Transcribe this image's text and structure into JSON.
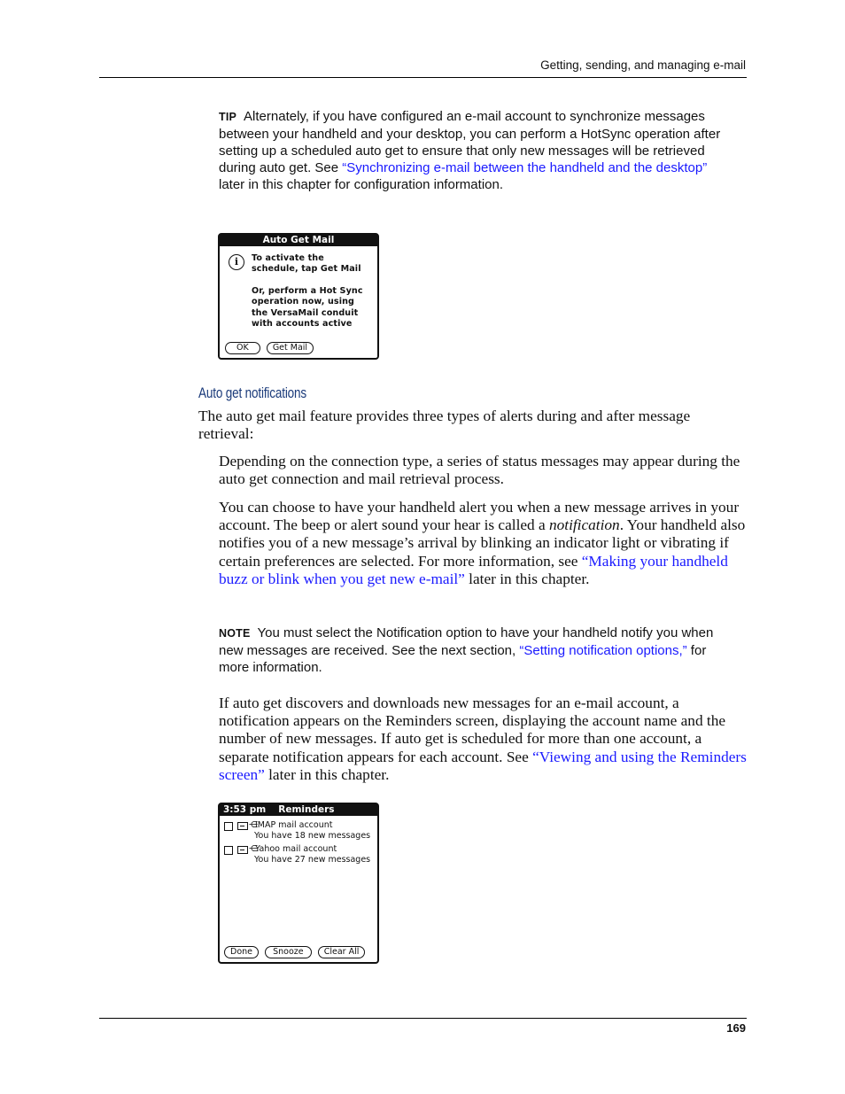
{
  "header": {
    "running_title": "Getting, sending, and managing e-mail"
  },
  "footer": {
    "page_number": "169"
  },
  "tip": {
    "label": "TIP",
    "text_before": "Alternately, if you have configured an e-mail account to synchronize messages between your handheld and your desktop, you can perform a HotSync operation after setting up a scheduled auto get to ensure that only new messages will be retrieved during auto get. See ",
    "link": "“Synchronizing e-mail between the handheld and the desktop”",
    "text_after": " later in this chapter for configuration information."
  },
  "auto_get_dialog": {
    "title": "Auto Get Mail",
    "icon": "info-icon",
    "message1": "To activate the schedule, tap Get Mail",
    "message2": "Or, perform a Hot Sync operation now, using the VersaMail conduit with accounts active",
    "buttons": {
      "ok": "OK",
      "get_mail": "Get Mail"
    }
  },
  "section": {
    "heading": "Auto get notifications",
    "intro": "The auto get mail feature provides three types of alerts during and after message retrieval:",
    "para1": "Depending on the connection type, a series of status messages may appear during the auto get connection and mail retrieval process.",
    "para2": {
      "before": "You can choose to have your handheld alert you when a new message arrives in your account. The beep or alert sound your hear is called a ",
      "italic": "notification",
      "middle": ". Your handheld also notifies you of a new message’s arrival by blinking an indicator light or vibrating if certain preferences are selected. For more information, see ",
      "link": "“Making your handheld buzz or blink when you get new e-mail”",
      "after": " later in this chapter."
    },
    "note": {
      "label": "NOTE",
      "before": "You must select the Notification option to have your handheld notify you when new messages are received. See the next section, ",
      "link": "“Setting notification options,”",
      "after": " for more information."
    },
    "para3": {
      "before": "If auto get discovers and downloads new messages for an e-mail account, a notification appears on the Reminders screen, displaying the account name and the number of new messages. If auto get is scheduled for more than one account, a separate notification appears for each account. See ",
      "link": "“Viewing and using the Reminders screen”",
      "after": " later in this chapter."
    }
  },
  "reminders_screen": {
    "time": "3:53 pm",
    "title": "Reminders",
    "items": [
      {
        "account": "IMAP mail account",
        "messages": "You have 18 new messages",
        "checked": false
      },
      {
        "account": "Yahoo mail account",
        "messages": "You have 27 new messages",
        "checked": false
      }
    ],
    "buttons": {
      "done": "Done",
      "snooze": "Snooze",
      "clear_all": "Clear All"
    }
  },
  "colors": {
    "link": "#1a1aff",
    "heading": "#1a3a7a"
  }
}
